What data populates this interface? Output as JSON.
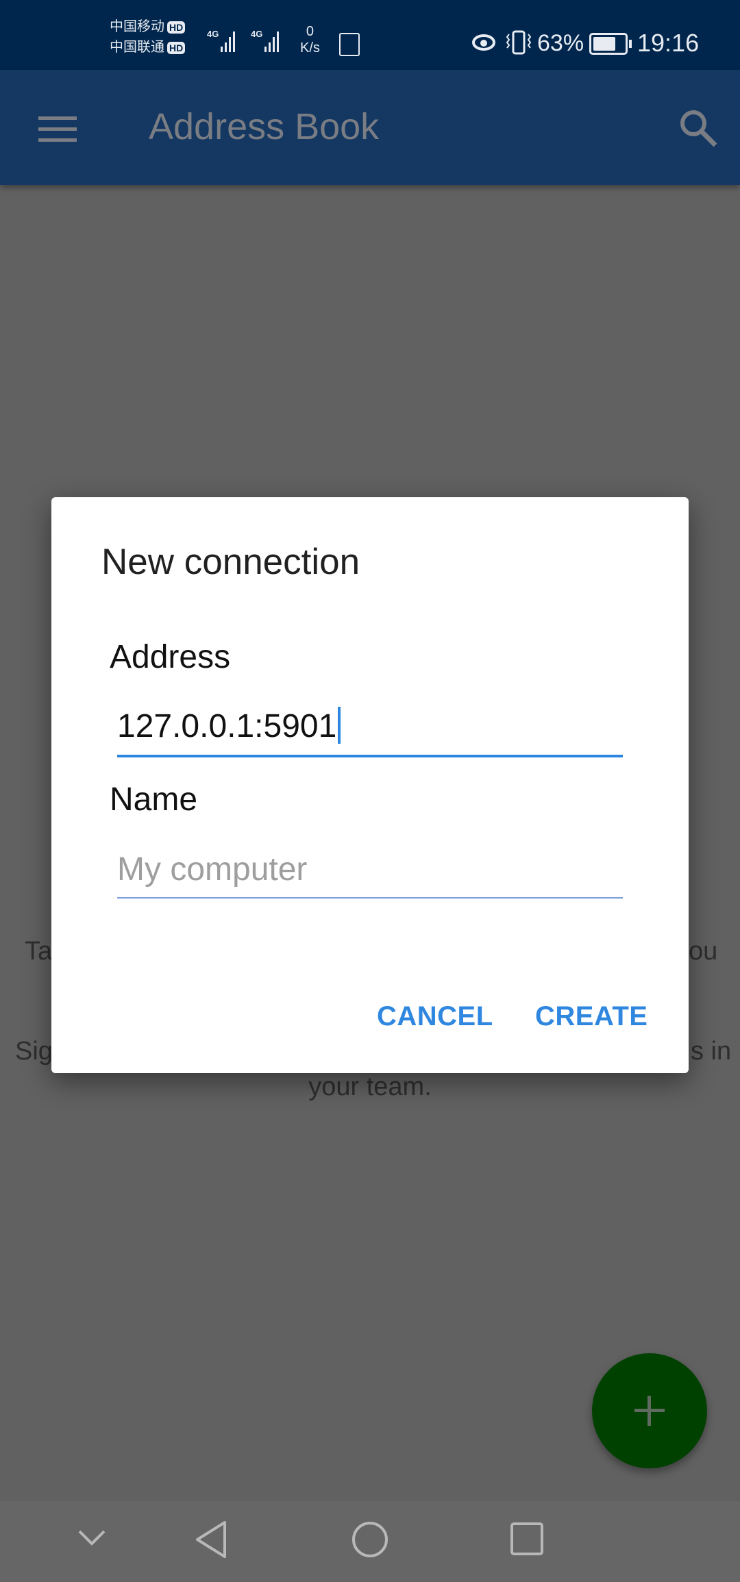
{
  "status_bar": {
    "carrier1": "中国移动",
    "carrier2": "中国联通",
    "hd_badge": "HD",
    "network1": "4G",
    "network2": "4G",
    "speed_value": "0",
    "speed_unit": "K/s",
    "battery_percent": "63%",
    "battery_level": 63,
    "time": "19:16"
  },
  "app_bar": {
    "title": "Address Book",
    "menu_icon": "hamburger-menu-icon",
    "search_icon": "search-icon"
  },
  "background": {
    "line1_left": "Ta",
    "line1_right": "ou",
    "line2_left": "Sig",
    "line2_right": "s in",
    "line3": "your team."
  },
  "dialog": {
    "title": "New connection",
    "address_label": "Address",
    "address_value": "127.0.0.1:5901",
    "name_label": "Name",
    "name_placeholder": "My computer",
    "cancel_label": "CANCEL",
    "create_label": "CREATE"
  },
  "fab": {
    "icon": "plus-icon",
    "color": "#004100"
  },
  "nav_bar": {
    "icons": [
      "chevron-down-icon",
      "back-icon",
      "home-icon",
      "recents-icon"
    ]
  },
  "colors": {
    "accent": "#2f87e0",
    "status_bar": "#00264d",
    "app_bar": "#143862"
  }
}
